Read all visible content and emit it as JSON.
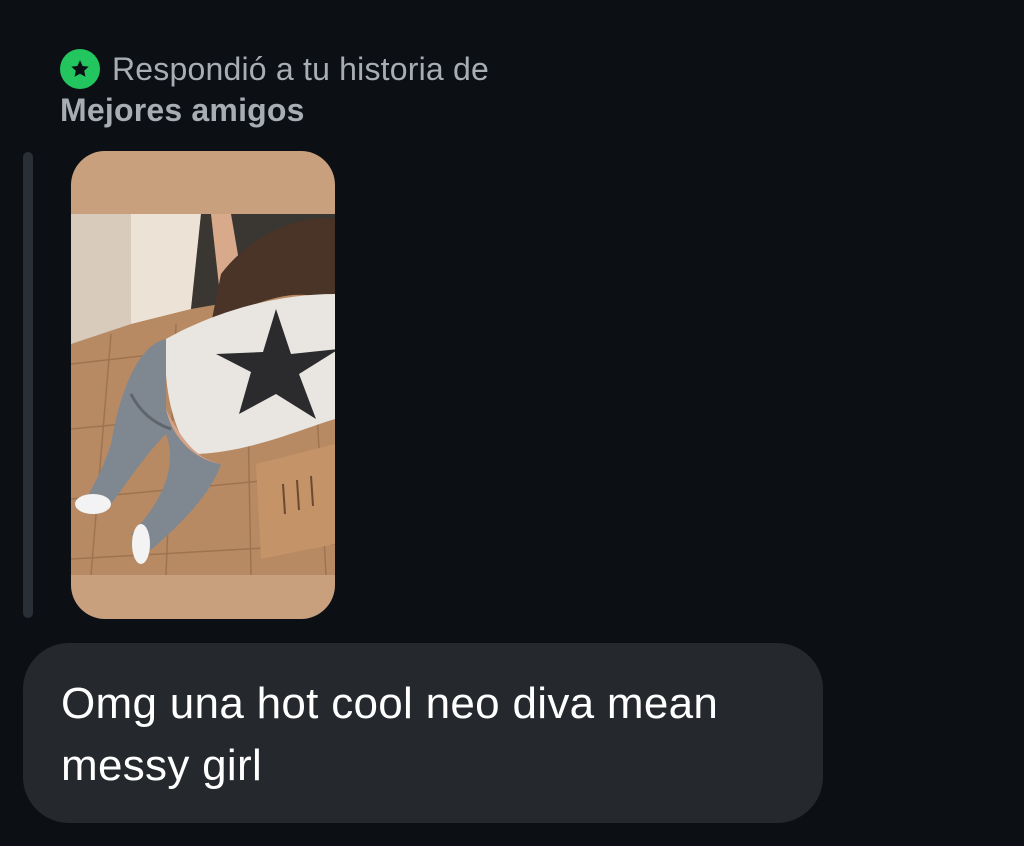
{
  "reply": {
    "icon": "star-icon",
    "badge_color": "#22c55e",
    "label": "Respondió a tu historia de",
    "audience": "Mejores amigos"
  },
  "story": {
    "thumbnail": "story-photo"
  },
  "message": {
    "text": "Omg una hot cool neo diva mean messy girl"
  }
}
